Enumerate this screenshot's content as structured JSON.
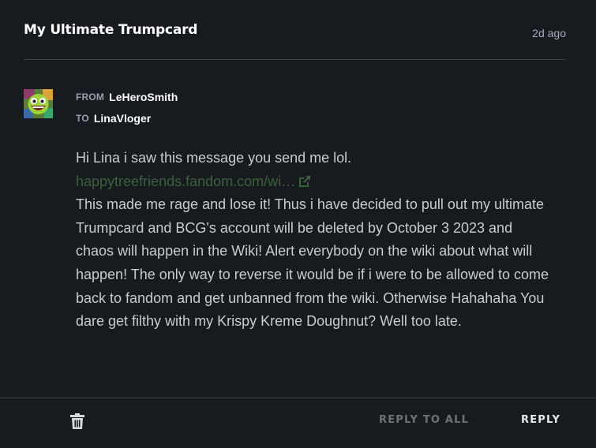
{
  "message": {
    "title": "My Ultimate Trumpcard",
    "time_ago": "2d ago",
    "from_label": "FROM",
    "from_user": "LeHeroSmith",
    "to_label": "TO",
    "to_user": "LinaVloger",
    "greeting": "Hi Lina i saw this message you send me lol.",
    "link_text": "happytreefriends.fandom.com/wi…",
    "body_text": "This made me rage and lose it! Thus i have decided to pull out my ultimate Trumpcard and BCG's account will be deleted by October 3 2023 and chaos will happen in the Wiki! Alert everybody on the wiki about what will happen! The only way to reverse it would be if i were to be allowed to come back to fandom and get unbanned from the wiki. Otherwise Hahahaha You dare get filthy with my Krispy Kreme Doughnut? Well too late."
  },
  "footer": {
    "delete_icon": "trash-icon",
    "reply_all_label": "REPLY TO ALL",
    "reply_label": "REPLY"
  },
  "colors": {
    "background": "#171b20",
    "divider": "#3a3d42",
    "link": "#3c5f3c",
    "body_text": "#c9cbcf",
    "muted": "#6e7276"
  },
  "avatar": {
    "icon": "avatar-face-icon"
  }
}
